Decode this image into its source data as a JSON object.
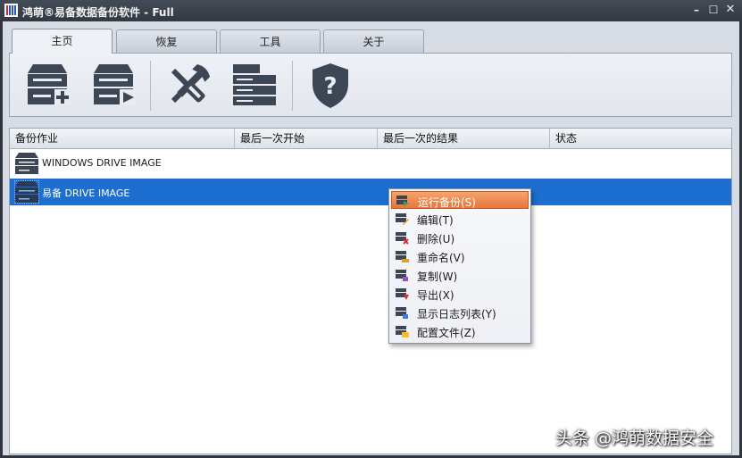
{
  "window": {
    "title": "鸿萌®易备数据备份软件 - Full",
    "controls": {
      "minimize": "–",
      "maximize": "☐",
      "close": "✕"
    }
  },
  "tabs": [
    {
      "label": "主页",
      "active": true
    },
    {
      "label": "恢复",
      "active": false
    },
    {
      "label": "工具",
      "active": false
    },
    {
      "label": "关于",
      "active": false
    }
  ],
  "ribbon": {
    "buttons": [
      {
        "icon": "new-backup-drive-icon"
      },
      {
        "icon": "run-backup-drive-icon"
      },
      {
        "icon": "tools-wrench-screwdriver-icon"
      },
      {
        "icon": "log-list-icon"
      },
      {
        "icon": "help-shield-icon"
      }
    ]
  },
  "list": {
    "columns": [
      "备份作业",
      "最后一次开始",
      "最后一次的结果",
      "状态"
    ],
    "rows": [
      {
        "name": "WINDOWS DRIVE IMAGE",
        "selected": false
      },
      {
        "name": "易备 DRIVE IMAGE",
        "selected": true
      }
    ]
  },
  "context_menu": {
    "items": [
      {
        "label": "运行备份(S)",
        "highlighted": true,
        "icon": "run-backup-icon"
      },
      {
        "label": "编辑(T)",
        "highlighted": false,
        "icon": "edit-icon"
      },
      {
        "label": "删除(U)",
        "highlighted": false,
        "icon": "delete-icon"
      },
      {
        "label": "重命名(V)",
        "highlighted": false,
        "icon": "rename-icon"
      },
      {
        "label": "复制(W)",
        "highlighted": false,
        "icon": "copy-icon"
      },
      {
        "label": "导出(X)",
        "highlighted": false,
        "icon": "export-icon"
      },
      {
        "label": "显示日志列表(Y)",
        "highlighted": false,
        "icon": "log-list-icon"
      },
      {
        "label": "配置文件(Z)",
        "highlighted": false,
        "icon": "config-file-icon"
      }
    ]
  },
  "watermark": "头条 @鸿萌数据安全",
  "colors": {
    "accent_selection": "#1c6fd0",
    "menu_highlight": "#e8743a",
    "icon_dark": "#3d4655",
    "titlebar": "#3a414b"
  }
}
